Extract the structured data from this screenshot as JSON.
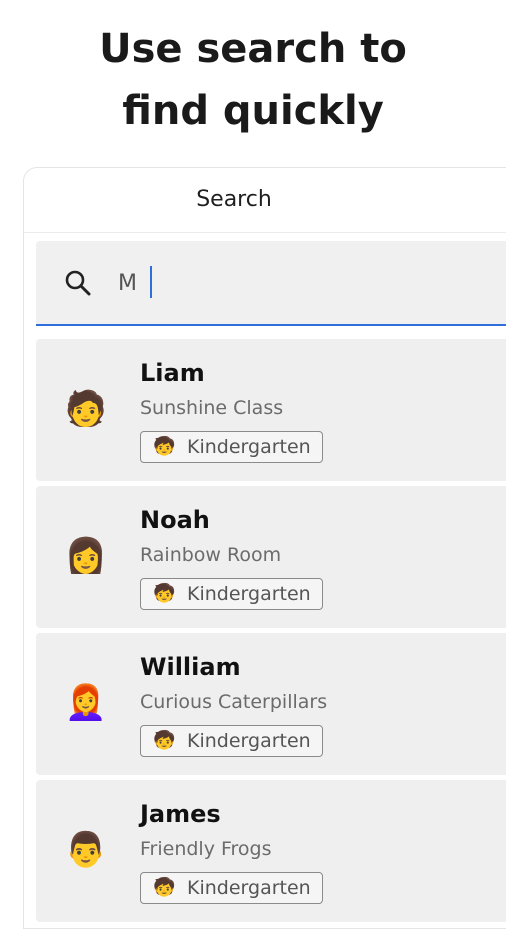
{
  "headline": {
    "line1": "Use search to",
    "line2": "find quickly"
  },
  "panel": {
    "title": "Search"
  },
  "search": {
    "value": "M",
    "icon": "search-icon",
    "accent_color": "#2f6fdd"
  },
  "results": [
    {
      "name": "Liam",
      "room": "Sunshine Class",
      "avatar": "🧑",
      "tag_icon": "🧒",
      "tag": "Kindergarten"
    },
    {
      "name": "Noah",
      "room": "Rainbow Room",
      "avatar": "👩",
      "tag_icon": "🧒",
      "tag": "Kindergarten"
    },
    {
      "name": "William",
      "room": "Curious Caterpillars",
      "avatar": "👩‍🦰",
      "tag_icon": "🧒",
      "tag": "Kindergarten"
    },
    {
      "name": "James",
      "room": "Friendly Frogs",
      "avatar": "👨",
      "tag_icon": "🧒",
      "tag": "Kindergarten"
    }
  ]
}
